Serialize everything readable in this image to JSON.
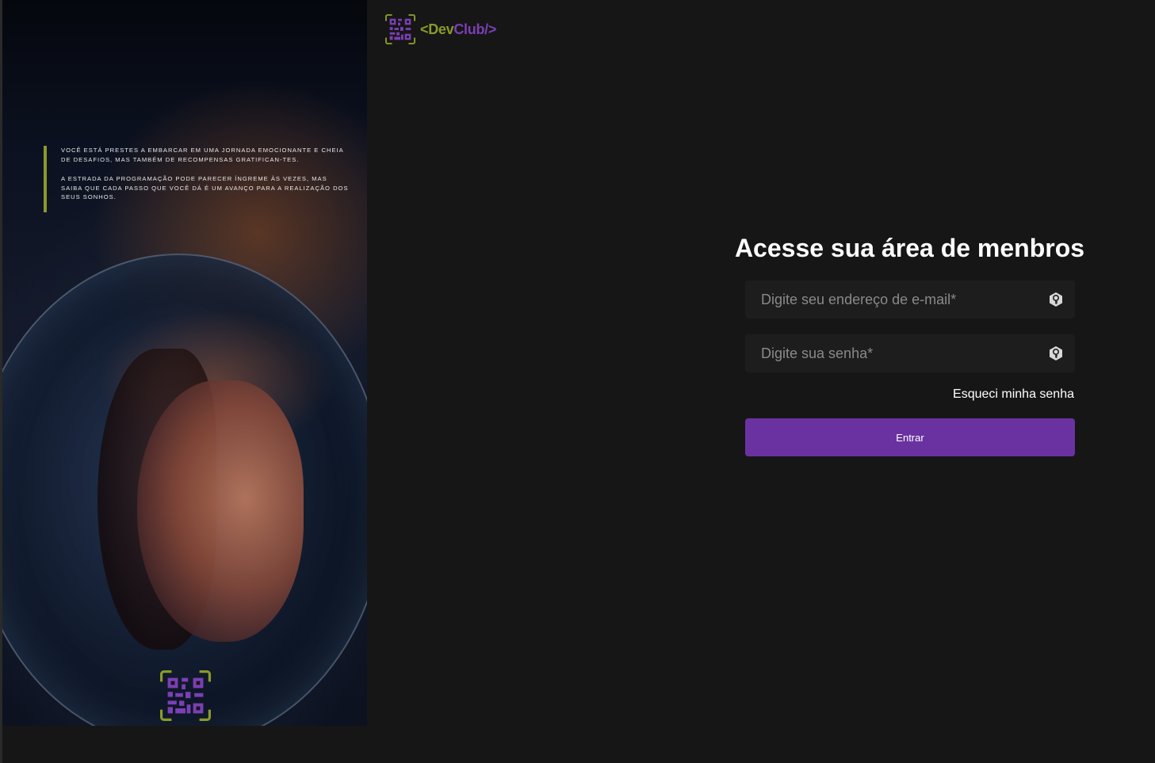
{
  "brand": {
    "logo_open": "<",
    "logo_dev": "Dev",
    "logo_club": "Club/>",
    "colors": {
      "olive": "#8a9a2a",
      "purple": "#7b3fb4",
      "button": "#6a32a0",
      "background": "#161616",
      "field": "#1d1d1d"
    }
  },
  "hero": {
    "quote_1": "Você está prestes a embarcar em uma jornada emocionante e cheia de desafios, mas também de recompensas gratifican-tes.",
    "quote_2": "A estrada da programação pode parecer íngreme às vezes, mas saiba que cada passo que você dá é um avanço para a realização dos seus sonhos."
  },
  "form": {
    "title": "Acesse sua área de menbros",
    "email_placeholder": "Digite seu endereço de e-mail*",
    "password_placeholder": "Digite sua senha*",
    "forgot_label": "Esqueci minha senha",
    "submit_label": "Entrar",
    "field_icon": "key-shield-icon"
  }
}
